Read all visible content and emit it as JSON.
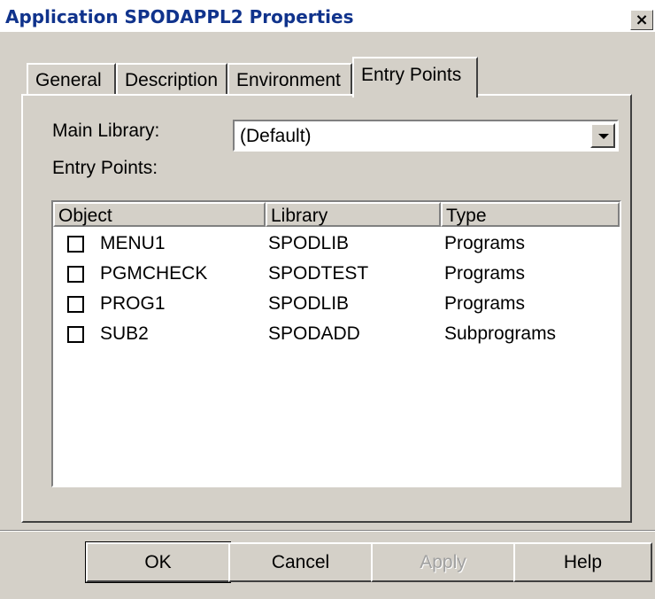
{
  "window": {
    "title": "Application SPODAPPL2 Properties",
    "close_label": "×"
  },
  "tabs": [
    {
      "label": "General",
      "active": false
    },
    {
      "label": "Description",
      "active": false
    },
    {
      "label": "Environment",
      "active": false
    },
    {
      "label": "Entry Points",
      "active": true
    }
  ],
  "main_library": {
    "label": "Main Library:",
    "value": "(Default)"
  },
  "entry_points": {
    "label": "Entry Points:",
    "columns": [
      "Object",
      "Library",
      "Type"
    ],
    "rows": [
      {
        "object": "MENU1",
        "library": "SPODLIB",
        "type": "Programs",
        "checked": false
      },
      {
        "object": "PGMCHECK",
        "library": "SPODTEST",
        "type": "Programs",
        "checked": false
      },
      {
        "object": "PROG1",
        "library": "SPODLIB",
        "type": "Programs",
        "checked": false
      },
      {
        "object": "SUB2",
        "library": "SPODADD",
        "type": "Subprograms",
        "checked": false
      }
    ]
  },
  "buttons": {
    "ok": "OK",
    "cancel": "Cancel",
    "apply": "Apply",
    "help": "Help"
  }
}
